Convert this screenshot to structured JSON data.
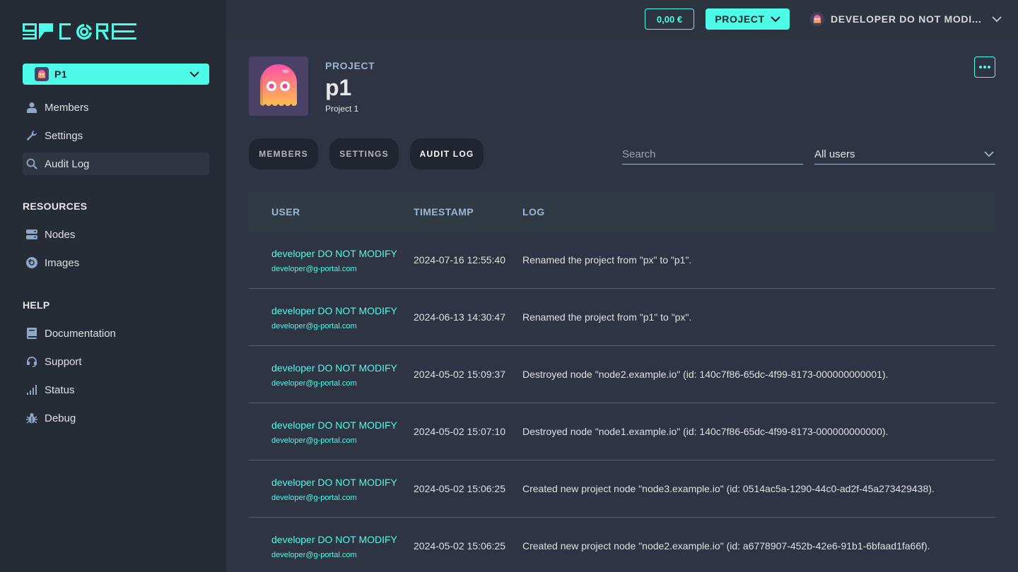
{
  "brand": {
    "logo_text": "CORE",
    "accent_color": "#4cfbe8"
  },
  "sidebar": {
    "project_selector": {
      "label": "P1"
    },
    "project_items": [
      {
        "label": "Members",
        "icon": "user-icon"
      },
      {
        "label": "Settings",
        "icon": "wrench-icon"
      },
      {
        "label": "Audit Log",
        "icon": "search-icon",
        "active": true
      }
    ],
    "resources_title": "RESOURCES",
    "resources_items": [
      {
        "label": "Nodes",
        "icon": "server-icon"
      },
      {
        "label": "Images",
        "icon": "disc-icon"
      }
    ],
    "help_title": "HELP",
    "help_items": [
      {
        "label": "Documentation",
        "icon": "book-icon"
      },
      {
        "label": "Support",
        "icon": "headset-icon"
      },
      {
        "label": "Status",
        "icon": "signal-icon"
      },
      {
        "label": "Debug",
        "icon": "bug-icon"
      }
    ]
  },
  "topbar": {
    "balance": "0,00 €",
    "project_button": "PROJECT",
    "user_name": "DEVELOPER DO NOT MODI..."
  },
  "project": {
    "kicker": "PROJECT",
    "name": "p1",
    "description": "Project 1"
  },
  "tabs": [
    {
      "label": "MEMBERS"
    },
    {
      "label": "SETTINGS"
    },
    {
      "label": "AUDIT LOG",
      "active": true
    }
  ],
  "filters": {
    "search_placeholder": "Search",
    "search_value": "",
    "user_filter_value": "All users"
  },
  "table": {
    "headers": {
      "user": "USER",
      "timestamp": "TIMESTAMP",
      "log": "LOG"
    },
    "rows": [
      {
        "user": "developer DO NOT MODIFY",
        "email": "developer@g-portal.com",
        "timestamp": "2024-07-16 12:55:40",
        "log": "Renamed the project from \"px\" to \"p1\"."
      },
      {
        "user": "developer DO NOT MODIFY",
        "email": "developer@g-portal.com",
        "timestamp": "2024-06-13 14:30:47",
        "log": "Renamed the project from \"p1\" to \"px\"."
      },
      {
        "user": "developer DO NOT MODIFY",
        "email": "developer@g-portal.com",
        "timestamp": "2024-05-02 15:09:37",
        "log": "Destroyed node \"node2.example.io\" (id: 140c7f86-65dc-4f99-8173-000000000001)."
      },
      {
        "user": "developer DO NOT MODIFY",
        "email": "developer@g-portal.com",
        "timestamp": "2024-05-02 15:07:10",
        "log": "Destroyed node \"node1.example.io\" (id: 140c7f86-65dc-4f99-8173-000000000000)."
      },
      {
        "user": "developer DO NOT MODIFY",
        "email": "developer@g-portal.com",
        "timestamp": "2024-05-02 15:06:25",
        "log": "Created new project node \"node3.example.io\" (id: 0514ac5a-1290-44c0-ad2f-45a273429438)."
      },
      {
        "user": "developer DO NOT MODIFY",
        "email": "developer@g-portal.com",
        "timestamp": "2024-05-02 15:06:25",
        "log": "Created new project node \"node2.example.io\" (id: a6778907-452b-42e6-91b1-6bfaad1fa66f)."
      }
    ]
  }
}
